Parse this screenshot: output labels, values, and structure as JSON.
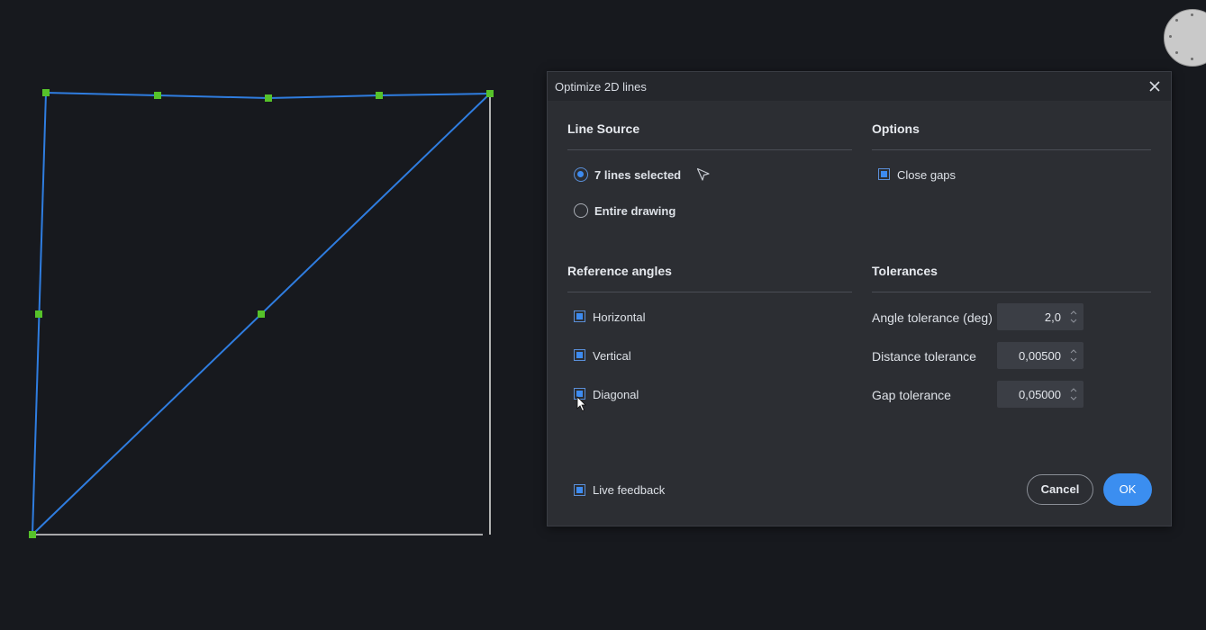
{
  "dialog": {
    "title": "Optimize 2D lines",
    "line_source": {
      "heading": "Line Source",
      "option_selected": "7 lines selected",
      "option_entire": "Entire drawing"
    },
    "options": {
      "heading": "Options",
      "close_gaps": "Close gaps"
    },
    "reference_angles": {
      "heading": "Reference angles",
      "horizontal": "Horizontal",
      "vertical": "Vertical",
      "diagonal": "Diagonal"
    },
    "tolerances": {
      "heading": "Tolerances",
      "angle_label": "Angle tolerance (deg)",
      "angle_value": "2,0",
      "distance_label": "Distance tolerance",
      "distance_value": "0,00500",
      "gap_label": "Gap tolerance",
      "gap_value": "0,05000"
    },
    "live_feedback": "Live feedback",
    "cancel_label": "Cancel",
    "ok_label": "OK"
  },
  "colors": {
    "background": "#17191e",
    "selected_line": "#2f7de0",
    "grip": "#56c22a",
    "unselected_line": "#d8d8d8",
    "accent": "#3b8ef0"
  }
}
